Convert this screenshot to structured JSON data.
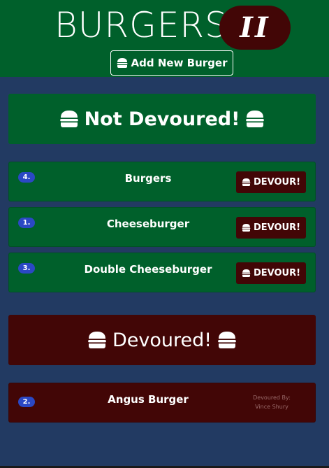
{
  "header": {
    "title": "BURGERS",
    "title_badge": "II",
    "add_button_label": "Add New Burger",
    "add_button_icon": "hamburger-icon"
  },
  "not_devoured": {
    "heading": "Not Devoured!",
    "items": [
      {
        "number": "4.",
        "name": "Burgers",
        "button_label": "DEVOUR!"
      },
      {
        "number": "1.",
        "name": "Cheeseburger",
        "button_label": "DEVOUR!"
      },
      {
        "number": "3.",
        "name": "Double Cheeseburger",
        "button_label": "DEVOUR!"
      }
    ]
  },
  "devoured": {
    "heading": "Devoured!",
    "items": [
      {
        "number": "2.",
        "name": "Angus Burger",
        "devoured_by_label": "Devoured By:",
        "devoured_by_name": "Vince Shury"
      }
    ]
  },
  "colors": {
    "background": "#223a62",
    "green": "#00602b",
    "maroon": "#420606",
    "badge": "#2b48c4"
  }
}
